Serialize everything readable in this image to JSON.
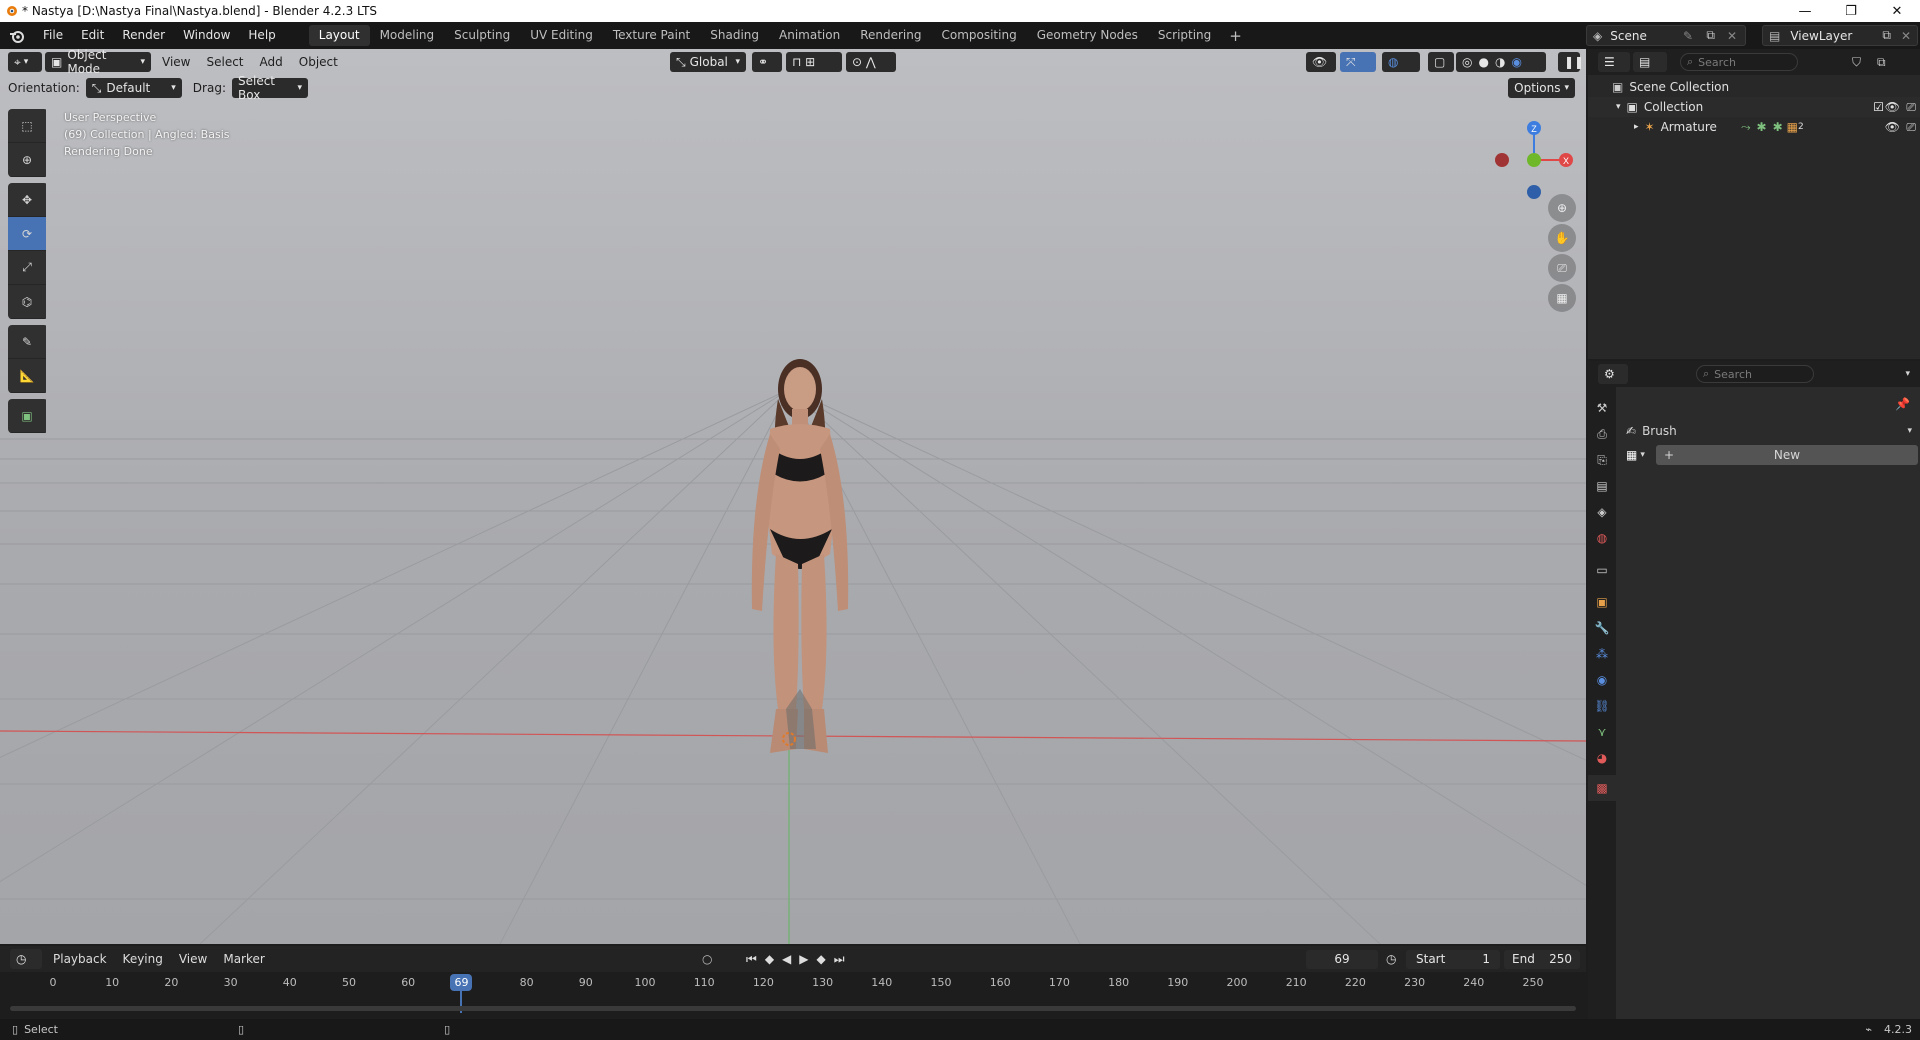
{
  "window": {
    "title": "* Nastya [D:\\Nastya Final\\Nastya.blend] - Blender 4.2.3 LTS",
    "minimize": "—",
    "restore": "❐",
    "close": "✕"
  },
  "menu": [
    "File",
    "Edit",
    "Render",
    "Window",
    "Help"
  ],
  "workspaces": [
    "Layout",
    "Modeling",
    "Sculpting",
    "UV Editing",
    "Texture Paint",
    "Shading",
    "Animation",
    "Rendering",
    "Compositing",
    "Geometry Nodes",
    "Scripting"
  ],
  "active_workspace": "Layout",
  "scene": {
    "name": "Scene",
    "view_layer": "ViewLayer"
  },
  "viewport": {
    "mode": "Object Mode",
    "menus": [
      "View",
      "Select",
      "Add",
      "Object"
    ],
    "transform_orientation": "Global",
    "orientation_label": "Orientation:",
    "orientation_value": "Default",
    "drag_label": "Drag:",
    "drag_value": "Select Box",
    "options_label": "Options",
    "info_line1": "User Perspective",
    "info_line2": "(69) Collection | Angled: Basis",
    "info_line3": "Rendering Done",
    "axis_z": "Z",
    "axis_x": "X"
  },
  "outliner": {
    "search_placeholder": "Search",
    "scene_collection": "Scene Collection",
    "collection": "Collection",
    "armature": "Armature",
    "armature_badge": "2"
  },
  "properties": {
    "search_placeholder": "Search",
    "brush_label": "Brush",
    "new_label": "New"
  },
  "timeline": {
    "menus": [
      "Playback",
      "Keying",
      "View",
      "Marker"
    ],
    "current_frame": "69",
    "start_label": "Start",
    "start_value": "1",
    "end_label": "End",
    "end_value": "250",
    "ticks": [
      "0",
      "10",
      "20",
      "30",
      "40",
      "50",
      "60",
      "80",
      "90",
      "100",
      "110",
      "120",
      "130",
      "140",
      "150",
      "160",
      "170",
      "180",
      "190",
      "200",
      "210",
      "220",
      "230",
      "240",
      "250"
    ],
    "playhead_label": "69"
  },
  "statusbar": {
    "select_label": "Select",
    "version": "4.2.3"
  },
  "colors": {
    "accent": "#4772b3",
    "viewport_bg": "#b3b4b8",
    "x_axis": "#e04848",
    "y_axis": "#6fb82a",
    "z_axis": "#3d7de0"
  }
}
